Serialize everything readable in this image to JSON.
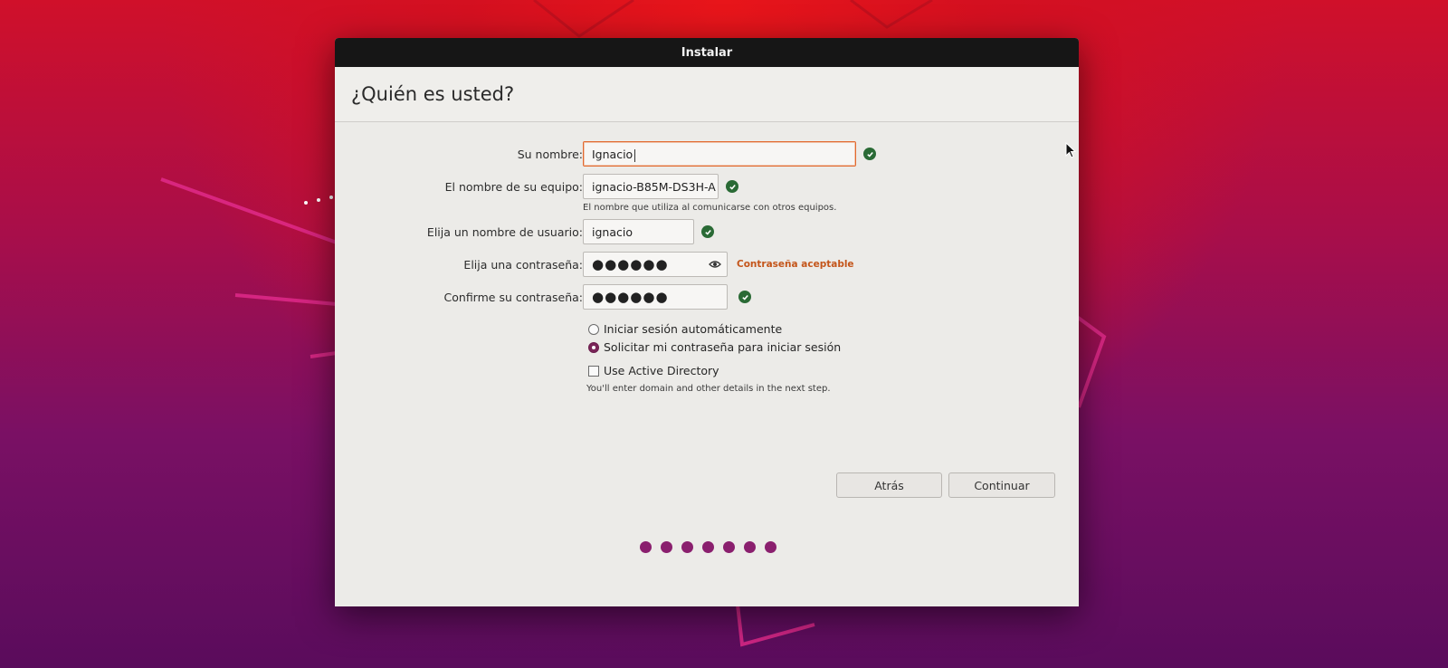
{
  "window": {
    "title": "Instalar"
  },
  "page": {
    "title": "¿Quién es usted?"
  },
  "form": {
    "name": {
      "label": "Su nombre:",
      "value": "Ignacio"
    },
    "computer": {
      "label": "El nombre de su equipo:",
      "value": "ignacio-B85M-DS3H-A",
      "hint": "El nombre que utiliza al comunicarse con otros equipos."
    },
    "username": {
      "label": "Elija un nombre de usuario:",
      "value": "ignacio"
    },
    "password": {
      "label": "Elija una contraseña:",
      "value": "●●●●●●",
      "strength": "Contraseña aceptable"
    },
    "confirm": {
      "label": "Confirme su contraseña:",
      "value": "●●●●●●"
    },
    "login_options": [
      {
        "label": "Iniciar sesión automáticamente",
        "selected": false
      },
      {
        "label": "Solicitar mi contraseña para iniciar sesión",
        "selected": true
      }
    ],
    "active_directory": {
      "label": "Use Active Directory",
      "checked": false,
      "hint": "You'll enter domain and other details in the next step."
    }
  },
  "buttons": {
    "back": "Atrás",
    "continue": "Continuar"
  },
  "progress": {
    "total_steps": 7
  },
  "colors": {
    "accent_check": "#2a6a35",
    "strength_text": "#c4551a",
    "progress_dot": "#8a1f6e"
  },
  "icons": {
    "valid": "check-circle-icon",
    "reveal": "eye-icon"
  }
}
